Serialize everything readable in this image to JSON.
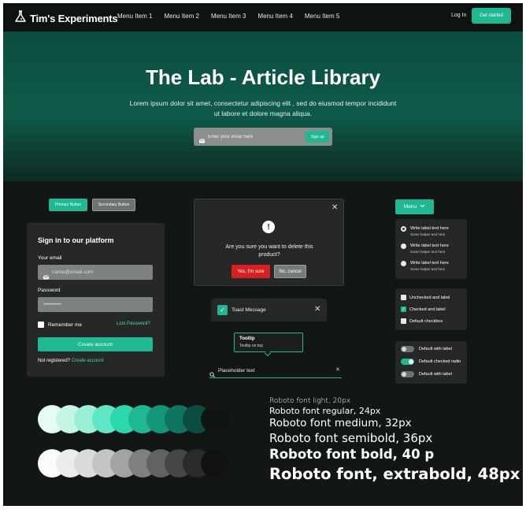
{
  "nav": {
    "logo": "Tim's Experiments",
    "menu": [
      "Menu Item 1",
      "Menu Item 2",
      "Menu Item 3",
      "Menu Item 4",
      "Menu Item 5"
    ],
    "login": "Log In",
    "cta": "Get started"
  },
  "hero": {
    "title": "The Lab - Article Library",
    "text": "Lorem ipsum dolor sit amet, consectetur adipiscing elit , sed do eiusmod tempor incididunt ut labore et dolore magna aliqua.",
    "email_placeholder": "Enter your email here",
    "signup": "Sign up"
  },
  "buttons": {
    "primary": "Primary Button",
    "secondary": "Secondary Button"
  },
  "signin": {
    "title": "Sign in to our platform",
    "email_label": "Your email",
    "email_placeholder": "name@email.com",
    "password_label": "Password",
    "password_placeholder": "••••••••••",
    "remember": "Remember me",
    "lost": "Lost Password?",
    "create": "Create account",
    "not_registered": "Not registered?",
    "create_link": "Create account"
  },
  "dialog": {
    "message": "Are you sure you want to delete this product?",
    "confirm": "Yes, I'm sure",
    "cancel": "No, cancel"
  },
  "toast": {
    "message": "Toast Message"
  },
  "tooltip": {
    "title": "Tooltip",
    "text": "Tooltip on top"
  },
  "search": {
    "placeholder": "Placeholder text"
  },
  "menu_button": {
    "label": "Menu"
  },
  "radios": [
    {
      "label": "Write label text here",
      "helper": "Some helper text here",
      "checked": true
    },
    {
      "label": "Write label text here",
      "helper": "Some helper text here",
      "checked": false
    },
    {
      "label": "Write label text here",
      "helper": "Some helper text here",
      "checked": false
    }
  ],
  "checkboxes": [
    {
      "label": "Unchecked and label",
      "checked": false
    },
    {
      "label": "Checked and label",
      "checked": true
    },
    {
      "label": "Default checkbox",
      "checked": false
    }
  ],
  "toggles": [
    {
      "label": "Default with label",
      "on": false
    },
    {
      "label": "Default checked radio",
      "on": true
    },
    {
      "label": "Default with label",
      "on": false
    }
  ],
  "palette": {
    "green": [
      "#e6fbf5",
      "#c4f5e6",
      "#9aefd7",
      "#5fe6c4",
      "#2dd8ae",
      "#1fb892",
      "#14967a",
      "#0f7560",
      "#0b4d3f",
      "#101512"
    ],
    "gray": [
      "#fbfbfb",
      "#ececec",
      "#dadada",
      "#c4c4c4",
      "#a3a3a3",
      "#7f7f7f",
      "#626262",
      "#464646",
      "#2a2a2a",
      "#121212"
    ]
  },
  "typography": [
    {
      "text": "Roboto font light, 20px"
    },
    {
      "text": "Roboto font regular, 24px"
    },
    {
      "text": "Roboto font medium, 32px"
    },
    {
      "text": "Roboto font semibold, 36px"
    },
    {
      "text": "Roboto font bold, 40 p"
    },
    {
      "text": "Roboto font, extrabold, 48px"
    }
  ],
  "colors": {
    "accent": "#1fb892",
    "danger": "#d92020",
    "background": "#121614",
    "card": "#262827"
  }
}
